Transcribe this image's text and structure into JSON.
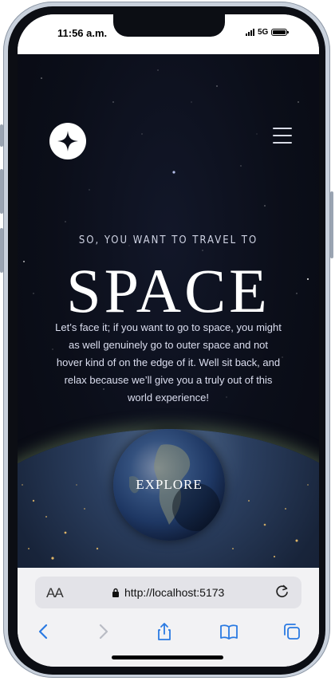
{
  "status_bar": {
    "time": "11:56 a.m.",
    "network": "5G"
  },
  "nav": {
    "logo_icon": "four-point-star-icon",
    "menu_icon": "hamburger-menu-icon"
  },
  "hero": {
    "eyebrow": "SO, YOU WANT TO TRAVEL TO",
    "title": "SPACE",
    "description": "Let’s face it; if you want to go to space, you might as well genuinely go to outer space and not hover kind of on the edge of it. Well sit back, and relax because we’ll give you a truly out of this world experience!",
    "cta_label": "EXPLORE"
  },
  "browser": {
    "text_size_label": "AA",
    "url": "http://localhost:5173",
    "icons": {
      "lock": "lock-icon",
      "reload": "reload-icon",
      "back": "back-icon",
      "forward": "forward-icon",
      "share": "share-icon",
      "bookmarks": "bookmarks-icon",
      "tabs": "tabs-icon"
    }
  },
  "colors": {
    "background": "#0b0e19",
    "accent_blue": "#2a7ae2",
    "text_light": "#ffffff"
  }
}
